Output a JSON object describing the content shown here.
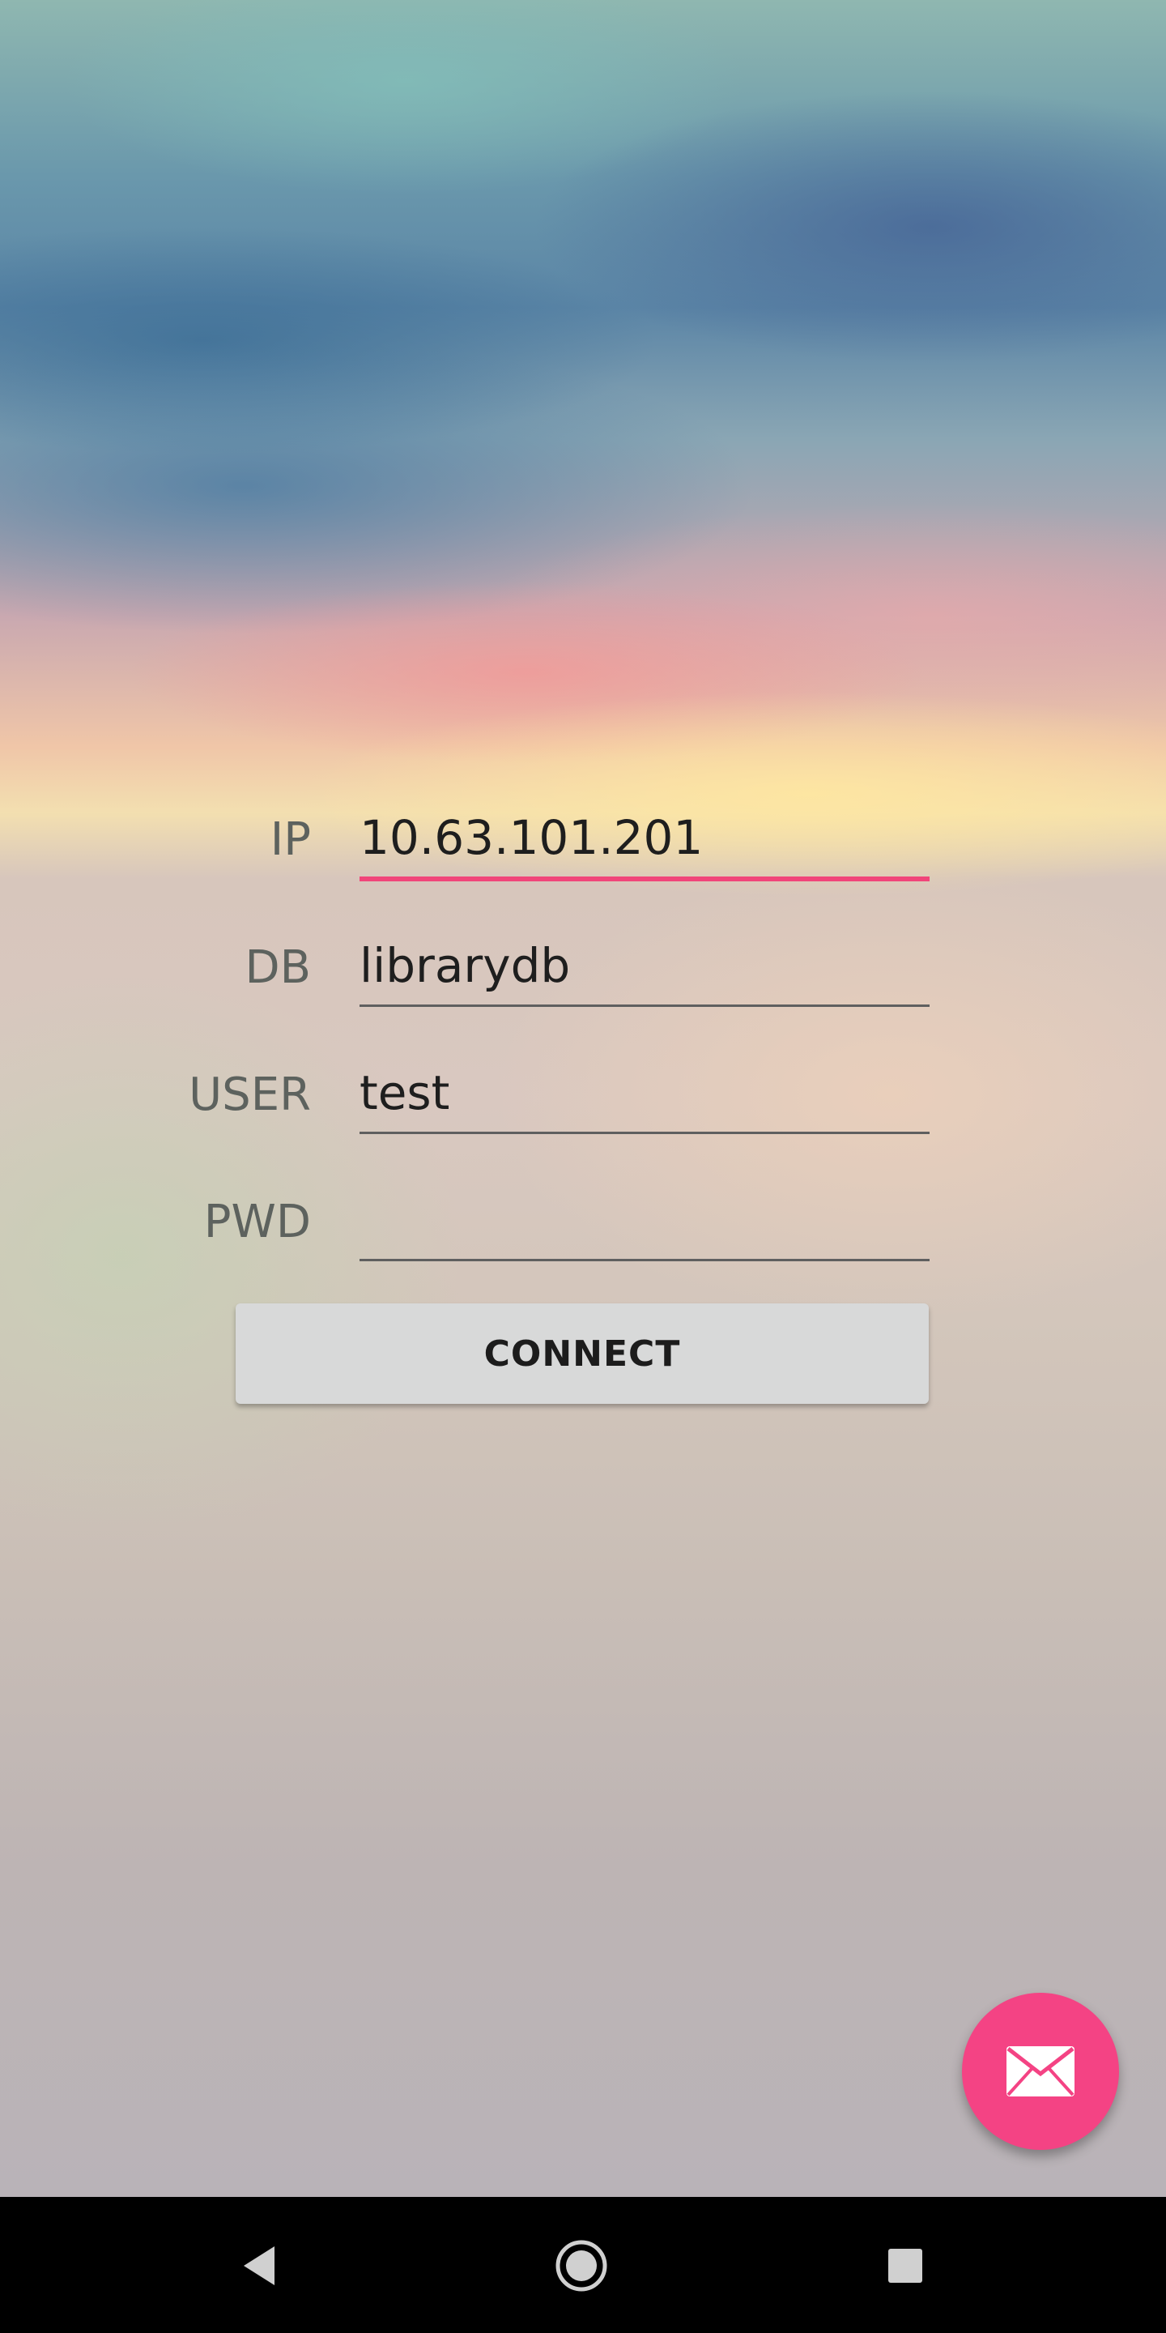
{
  "form": {
    "fields": [
      {
        "label": "IP",
        "value": "10.63.101.201",
        "focused": true
      },
      {
        "label": "DB",
        "value": "librarydb",
        "focused": false
      },
      {
        "label": "USER",
        "value": "test",
        "focused": false
      },
      {
        "label": "PWD",
        "value": "",
        "focused": false
      }
    ],
    "connect_label": "CONNECT"
  },
  "fab": {
    "icon": "mail-icon",
    "color": "#f44384"
  },
  "accent_color": "#f1457a",
  "navbar": {
    "back_icon": "back-triangle-icon",
    "home_icon": "home-circle-icon",
    "recents_icon": "recents-square-icon"
  }
}
